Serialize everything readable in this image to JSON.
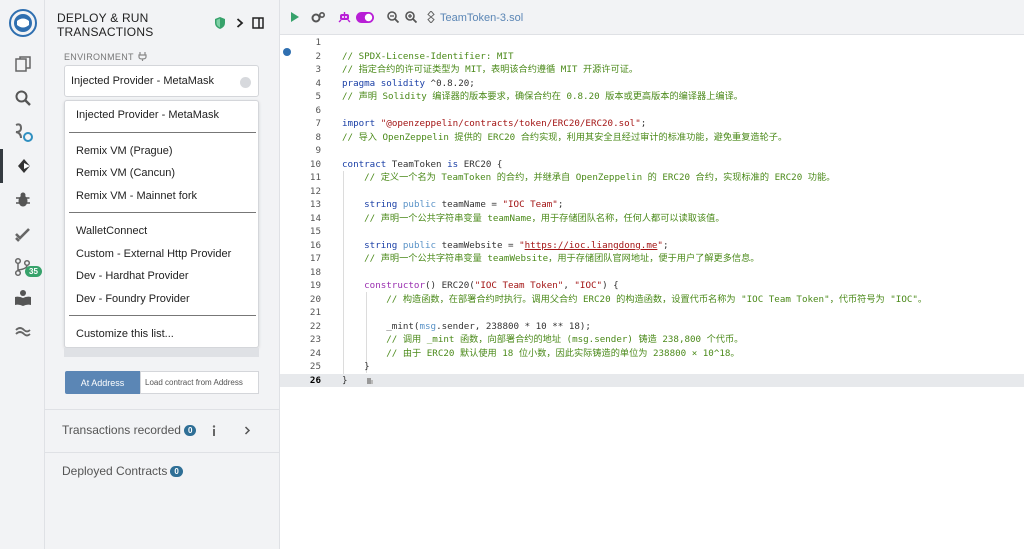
{
  "panel": {
    "title": "DEPLOY & RUN\nTRANSACTIONS",
    "environment_label": "ENVIRONMENT",
    "environment_selected": "Injected Provider - MetaMask",
    "dropdown_groups": [
      [
        "Injected Provider - MetaMask"
      ],
      [
        "Remix VM (Prague)",
        "Remix VM (Cancun)",
        "Remix VM - Mainnet fork"
      ],
      [
        "WalletConnect",
        "Custom - External Http Provider",
        "Dev - Hardhat Provider",
        "Dev - Foundry Provider"
      ],
      [
        "Customize this list..."
      ]
    ],
    "at_address_label": "At Address",
    "load_placeholder": "Load contract from Address",
    "transactions_label": "Transactions recorded",
    "transactions_count": "0",
    "deployed_label": "Deployed Contracts",
    "deployed_count": "0"
  },
  "rail": {
    "git_badge": "35"
  },
  "editor": {
    "tab_name": "TeamToken-3.sol",
    "highlight_line": 26
  },
  "code_lines": [
    {
      "n": "1",
      "t": [
        [
          "",
          ""
        ]
      ]
    },
    {
      "n": "2",
      "t": [
        [
          "cm",
          "// SPDX-License-Identifier: MIT"
        ]
      ]
    },
    {
      "n": "3",
      "t": [
        [
          "cm",
          "// 指定合约的许可证类型为 MIT，表明该合约遵循 MIT 开源许可证。"
        ]
      ]
    },
    {
      "n": "4",
      "t": [
        [
          "kw",
          "pragma"
        ],
        [
          "",
          " "
        ],
        [
          "kw",
          "solidity"
        ],
        [
          "",
          " ^0.8.20;"
        ]
      ]
    },
    {
      "n": "5",
      "t": [
        [
          "cm",
          "// 声明 Solidity 编译器的版本要求，确保合约在 0.8.20 版本或更高版本的编译器上编译。"
        ]
      ]
    },
    {
      "n": "6",
      "t": [
        [
          "",
          ""
        ]
      ]
    },
    {
      "n": "7",
      "t": [
        [
          "kw",
          "import"
        ],
        [
          "",
          " "
        ],
        [
          "st",
          "\"@openzeppelin/contracts/token/ERC20/ERC20.sol\""
        ],
        [
          "",
          ";"
        ]
      ]
    },
    {
      "n": "8",
      "t": [
        [
          "cm",
          "// 导入 OpenZeppelin 提供的 ERC20 合约实现，利用其安全且经过审计的标准功能，避免重复造轮子。"
        ]
      ]
    },
    {
      "n": "9",
      "t": [
        [
          "",
          ""
        ]
      ]
    },
    {
      "n": "10",
      "t": [
        [
          "kw",
          "contract"
        ],
        [
          "",
          " TeamToken "
        ],
        [
          "kw",
          "is"
        ],
        [
          "",
          " ERC20 {"
        ]
      ]
    },
    {
      "n": "11",
      "t": [
        [
          "",
          "    "
        ],
        [
          "cm",
          "// 定义一个名为 TeamToken 的合约，并继承自 OpenZeppelin 的 ERC20 合约，实现标准的 ERC20 功能。"
        ]
      ]
    },
    {
      "n": "12",
      "t": [
        [
          "",
          ""
        ]
      ]
    },
    {
      "n": "13",
      "t": [
        [
          "",
          "    "
        ],
        [
          "ty",
          "string"
        ],
        [
          "",
          " "
        ],
        [
          "mod",
          "public"
        ],
        [
          "",
          " teamName = "
        ],
        [
          "st",
          "\"IOC Team\""
        ],
        [
          "",
          ";"
        ]
      ]
    },
    {
      "n": "14",
      "t": [
        [
          "",
          "    "
        ],
        [
          "cm",
          "// 声明一个公共字符串变量 teamName，用于存储团队名称，任何人都可以读取该值。"
        ]
      ]
    },
    {
      "n": "15",
      "t": [
        [
          "",
          ""
        ]
      ]
    },
    {
      "n": "16",
      "t": [
        [
          "",
          "    "
        ],
        [
          "ty",
          "string"
        ],
        [
          "",
          " "
        ],
        [
          "mod",
          "public"
        ],
        [
          "",
          " teamWebsite = "
        ],
        [
          "st",
          "\""
        ],
        [
          "url",
          "https://ioc.liangdong.me"
        ],
        [
          "st",
          "\""
        ],
        [
          "",
          ";"
        ]
      ]
    },
    {
      "n": "17",
      "t": [
        [
          "",
          "    "
        ],
        [
          "cm",
          "// 声明一个公共字符串变量 teamWebsite，用于存储团队官网地址，便于用户了解更多信息。"
        ]
      ]
    },
    {
      "n": "18",
      "t": [
        [
          "",
          ""
        ]
      ]
    },
    {
      "n": "19",
      "t": [
        [
          "",
          "    "
        ],
        [
          "fn",
          "constructor"
        ],
        [
          "",
          "() ERC20("
        ],
        [
          "st",
          "\"IOC Team Token\""
        ],
        [
          "",
          ", "
        ],
        [
          "st",
          "\"IOC\""
        ],
        [
          "",
          ") {"
        ]
      ]
    },
    {
      "n": "20",
      "t": [
        [
          "",
          "        "
        ],
        [
          "cm",
          "// 构造函数，在部署合约时执行。调用父合约 ERC20 的构造函数，设置代币名称为 \"IOC Team Token\"，代币符号为 \"IOC\"。"
        ]
      ]
    },
    {
      "n": "21",
      "t": [
        [
          "",
          ""
        ]
      ]
    },
    {
      "n": "22",
      "t": [
        [
          "",
          "        _mint("
        ],
        [
          "mod",
          "msg"
        ],
        [
          "",
          ".sender, 238800 * 10 ** 18);"
        ]
      ]
    },
    {
      "n": "23",
      "t": [
        [
          "",
          "        "
        ],
        [
          "cm",
          "// 调用 _mint 函数，向部署合约的地址 (msg.sender) 铸造 238,800 个代币。"
        ]
      ]
    },
    {
      "n": "24",
      "t": [
        [
          "",
          "        "
        ],
        [
          "cm",
          "// 由于 ERC20 默认使用 18 位小数，因此实际铸造的单位为 238800 × 10^18。"
        ]
      ]
    },
    {
      "n": "25",
      "t": [
        [
          "",
          "    }"
        ]
      ]
    },
    {
      "n": "26",
      "t": [
        [
          "",
          "}"
        ]
      ]
    }
  ]
}
